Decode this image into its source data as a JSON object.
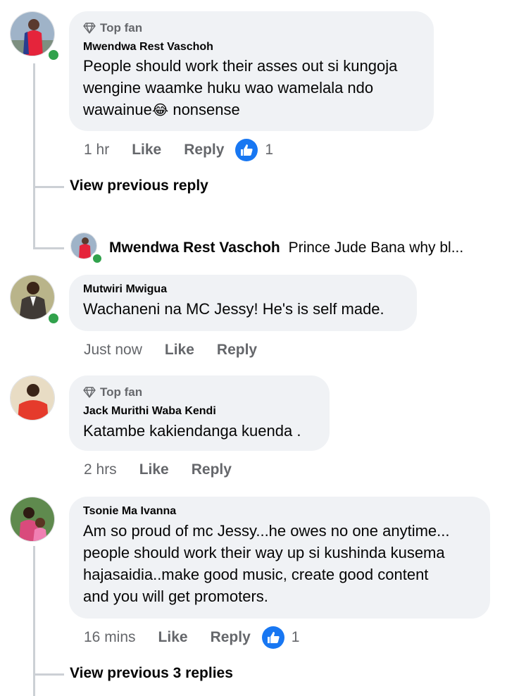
{
  "comments": [
    {
      "badge": "Top fan",
      "author": "Mwendwa Rest Vaschoh",
      "text_lines": [
        "People should work their asses out si kungoja",
        "wengine waamke huku wao wamelala ndo",
        "wawainue"
      ],
      "text_suffix": " nonsense",
      "emoji": "😂",
      "time": "1 hr",
      "like": "Like",
      "reply": "Reply",
      "reactions": "1"
    },
    {
      "author": "Mutwiri Mwigua",
      "text": "Wachaneni na MC Jessy! He's is self made.",
      "time": "Just now",
      "like": "Like",
      "reply": "Reply"
    },
    {
      "badge": "Top fan",
      "author": "Jack Murithi Waba Kendi",
      "text": "Katambe kakiendanga kuenda .",
      "time": "2 hrs",
      "like": "Like",
      "reply": "Reply"
    },
    {
      "author": "Tsonie Ma Ivanna",
      "text_lines": [
        "Am so proud of mc Jessy...he owes no one anytime...",
        "people should work their way up si kushinda kusema",
        "hajasaidia..make good music, create good content",
        "and you will get promoters."
      ],
      "time": "16 mins",
      "like": "Like",
      "reply": "Reply",
      "reactions": "1"
    }
  ],
  "view_previous_reply": "View previous reply",
  "reply_preview": {
    "author": "Mwendwa Rest Vaschoh",
    "text": "Prince Jude Bana why bl..."
  },
  "view_previous_replies": "View previous 3 replies",
  "colors": {
    "bubble": "#f0f2f5",
    "meta": "#65676b",
    "like_blue": "#1877f2",
    "online": "#31a24c"
  }
}
